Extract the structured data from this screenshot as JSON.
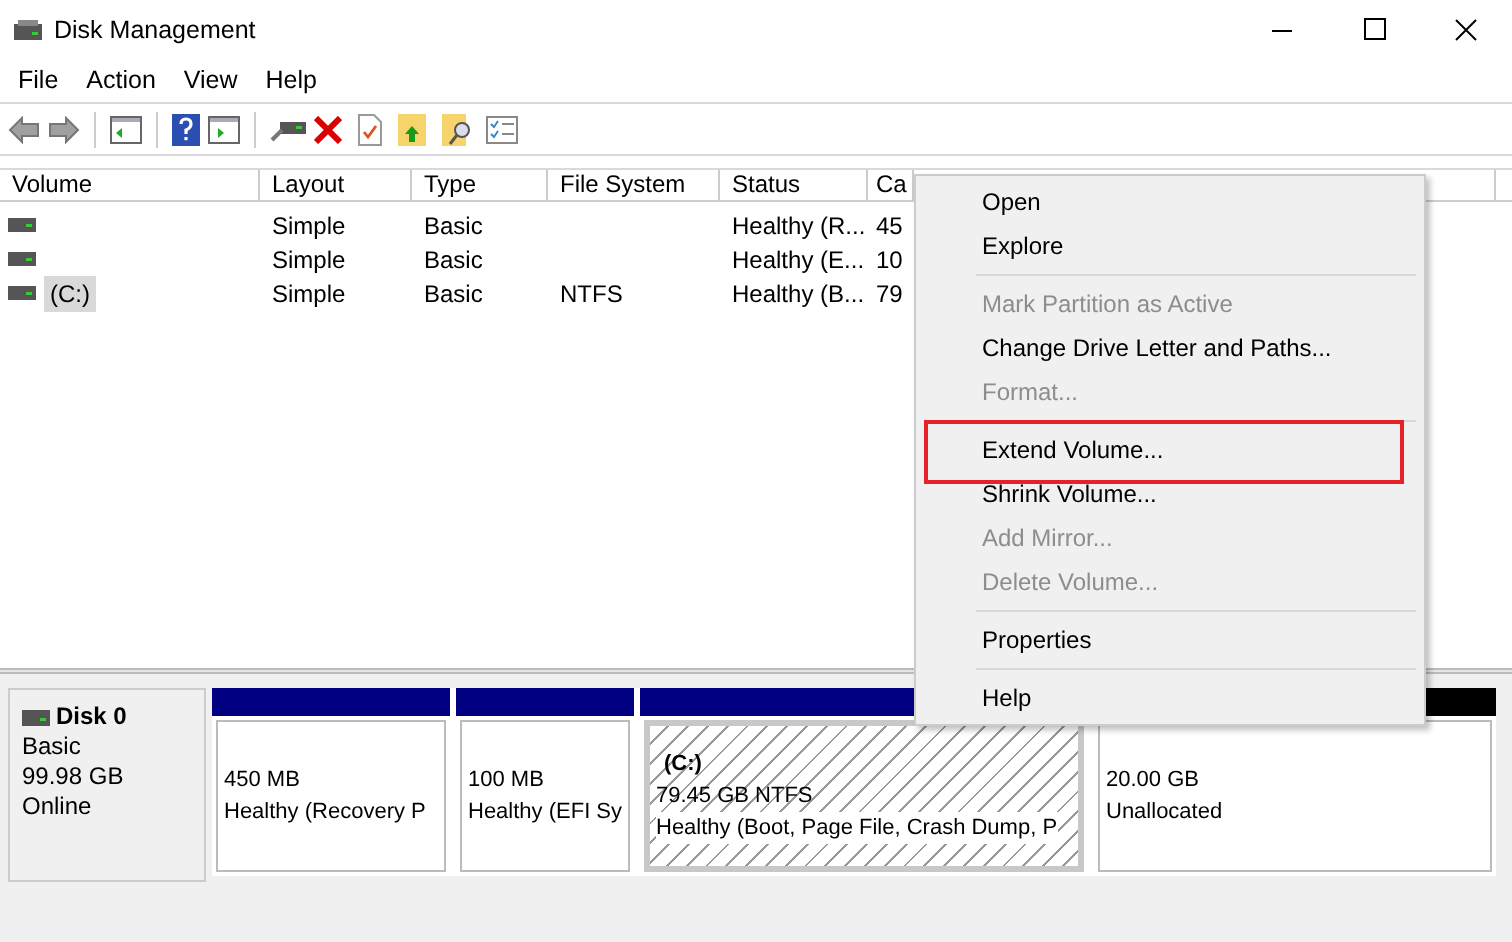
{
  "window": {
    "title": "Disk Management"
  },
  "menu_bar": [
    "File",
    "Action",
    "View",
    "Help"
  ],
  "volume_list": {
    "columns": [
      "Volume",
      "Layout",
      "Type",
      "File System",
      "Status",
      "Ca"
    ],
    "rows": [
      {
        "layout": "Simple",
        "type": "Basic",
        "status": "Healthy (R...",
        "capacity": "45",
        "selected": false
      },
      {
        "layout": "Simple",
        "type": "Basic",
        "status": "Healthy (E...",
        "capacity": "10",
        "selected": false
      },
      {
        "volume": "(C:)",
        "layout": "Simple",
        "type": "Basic",
        "file_system": "NTFS",
        "status": "Healthy (B...",
        "capacity": "79",
        "selected": true
      }
    ]
  },
  "disk": {
    "name": "Disk 0",
    "type": "Basic",
    "size": "99.98 GB",
    "status": "Online",
    "partitions": [
      {
        "kind": "primary",
        "size": "450 MB",
        "status": "Healthy (Recovery P",
        "selected": false
      },
      {
        "kind": "primary",
        "size": "100 MB",
        "status": "Healthy (EFI Sy",
        "selected": false
      },
      {
        "kind": "primary",
        "label": "(C:)",
        "size": "79.45 GB NTFS",
        "status": "Healthy (Boot, Page File, Crash Dump, P",
        "selected": true
      },
      {
        "kind": "unallocated",
        "size": "20.00 GB",
        "status": "Unallocated",
        "selected": false
      }
    ]
  },
  "context_menu": [
    {
      "kind": "item",
      "label": "Open",
      "disabled": false,
      "outlined": false
    },
    {
      "kind": "item",
      "label": "Explore",
      "disabled": false,
      "outlined": false
    },
    {
      "kind": "separator"
    },
    {
      "kind": "item",
      "label": "Mark Partition as Active",
      "disabled": true,
      "outlined": false
    },
    {
      "kind": "item",
      "label": "Change Drive Letter and Paths...",
      "disabled": false,
      "outlined": false
    },
    {
      "kind": "item",
      "label": "Format...",
      "disabled": true,
      "outlined": false
    },
    {
      "kind": "separator"
    },
    {
      "kind": "item",
      "label": "Extend Volume...",
      "disabled": false,
      "outlined": true
    },
    {
      "kind": "item",
      "label": "Shrink Volume...",
      "disabled": false,
      "outlined": false
    },
    {
      "kind": "item",
      "label": "Add Mirror...",
      "disabled": true,
      "outlined": false
    },
    {
      "kind": "item",
      "label": "Delete Volume...",
      "disabled": true,
      "outlined": false
    },
    {
      "kind": "separator"
    },
    {
      "kind": "item",
      "label": "Properties",
      "disabled": false,
      "outlined": false
    },
    {
      "kind": "separator"
    },
    {
      "kind": "item",
      "label": "Help",
      "disabled": false,
      "outlined": false
    }
  ]
}
